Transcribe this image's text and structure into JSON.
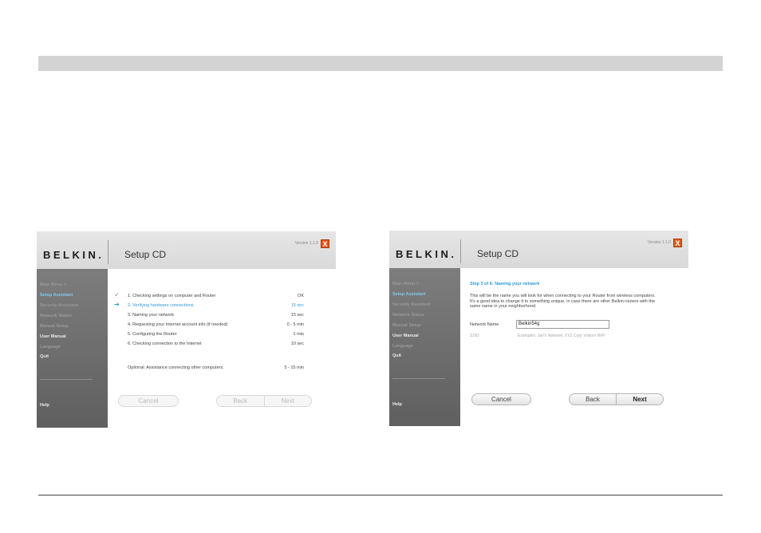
{
  "screens": [
    {
      "logo": "BELKIN.",
      "title": "Setup CD",
      "version": "Version 1.1.0",
      "close": "X",
      "sidebar": {
        "items": [
          "Main Menu  >",
          "Setup Assistant",
          "Security Assistant",
          "Network Status",
          "Manual Setup",
          "User Manual",
          "Language",
          "Quit"
        ],
        "help": "Help"
      },
      "steps": [
        {
          "label": "1. Checking settings on computer and Router",
          "time": "OK"
        },
        {
          "label": "2. Verifying hardware connections",
          "time": "15 sec"
        },
        {
          "label": "3. Naming your network",
          "time": "15 sec"
        },
        {
          "label": "4. Requesting your Internet account info (if needed)",
          "time": "0 - 5 min"
        },
        {
          "label": "5. Configuring the Router",
          "time": "1 min"
        },
        {
          "label": "6. Checking connection to the Internet",
          "time": "10 sec"
        }
      ],
      "optional": {
        "label": "Optional: Assistance connecting other computers.",
        "time": "5 - 15 min"
      },
      "buttons": {
        "cancel": "Cancel",
        "back": "Back",
        "next": "Next"
      }
    },
    {
      "logo": "BELKIN.",
      "title": "Setup CD",
      "version": "Version 1.1.0",
      "close": "X",
      "sidebar": {
        "items": [
          "Main Menu  >",
          "Setup Assistant",
          "Security Assistant",
          "Network Status",
          "Manual Setup",
          "User Manual",
          "Language",
          "Quit"
        ],
        "help": "Help"
      },
      "step_title": "Step 3 of 6: Naming your network",
      "description": "This will be the name you will look for when connecting to your Router from wireless computers. It's a good idea to change it to something unique, in case there are other Belkin routers with the same name in your neighborhood.",
      "network_name_label": "Network Name",
      "network_name_value": "Belkin54g",
      "ssid_label": "SSID",
      "ssid_example": "Examples: Jan's Network, XYZ Corp Visitors WiFi",
      "buttons": {
        "cancel": "Cancel",
        "back": "Back",
        "next": "Next"
      }
    }
  ]
}
